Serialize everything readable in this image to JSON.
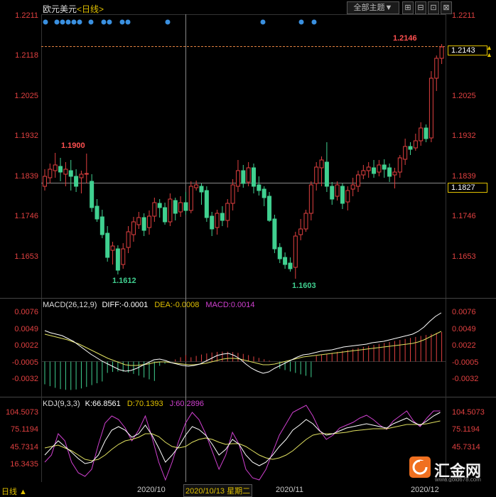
{
  "header": {
    "symbol": "欧元美元",
    "timeframe": "<日线>",
    "period_select_label": "全部主题▼",
    "win_buttons": [
      "⊞",
      "⊟",
      "⊡",
      "⊠"
    ]
  },
  "main_chart": {
    "price_axis": [
      "1.2211",
      "1.2118",
      "1.2025",
      "1.1932",
      "1.1839",
      "1.1746",
      "1.1653"
    ],
    "high_marker": "1.2146",
    "label_1900": "1.1900",
    "label_1612": "1.1612",
    "label_1603": "1.1603",
    "current_box": "1.2143",
    "crosshair_box": "1.1827",
    "up_arrow": "▲"
  },
  "macd": {
    "label": "MACD(26,12,9)",
    "diff": "DIFF:-0.0001",
    "dea": "DEA:-0.0008",
    "macd_val": "MACD:0.0014",
    "axis": [
      "0.0076",
      "0.0049",
      "0.0022",
      "-0.0005",
      "-0.0032"
    ]
  },
  "kdj": {
    "label": "KDJ(9,3,3)",
    "k": "K:66.8561",
    "d": "D:70.1393",
    "j": "J:60.2896",
    "axis": [
      "104.5073",
      "75.1194",
      "45.7314",
      "16.3435"
    ]
  },
  "bottom": {
    "d1": "2020/10",
    "d2": "2020/10/13 星期二",
    "d3": "2020/11",
    "d4": "2020/12",
    "left_label": "日线 ▲"
  },
  "watermark": "汇金网",
  "watermark_sub": "www.gold678.com",
  "colors": {
    "up": "#e04040",
    "down": "#40d090",
    "white": "#ffffff",
    "yellow": "#e0c000",
    "magenta": "#d040d0"
  }
}
